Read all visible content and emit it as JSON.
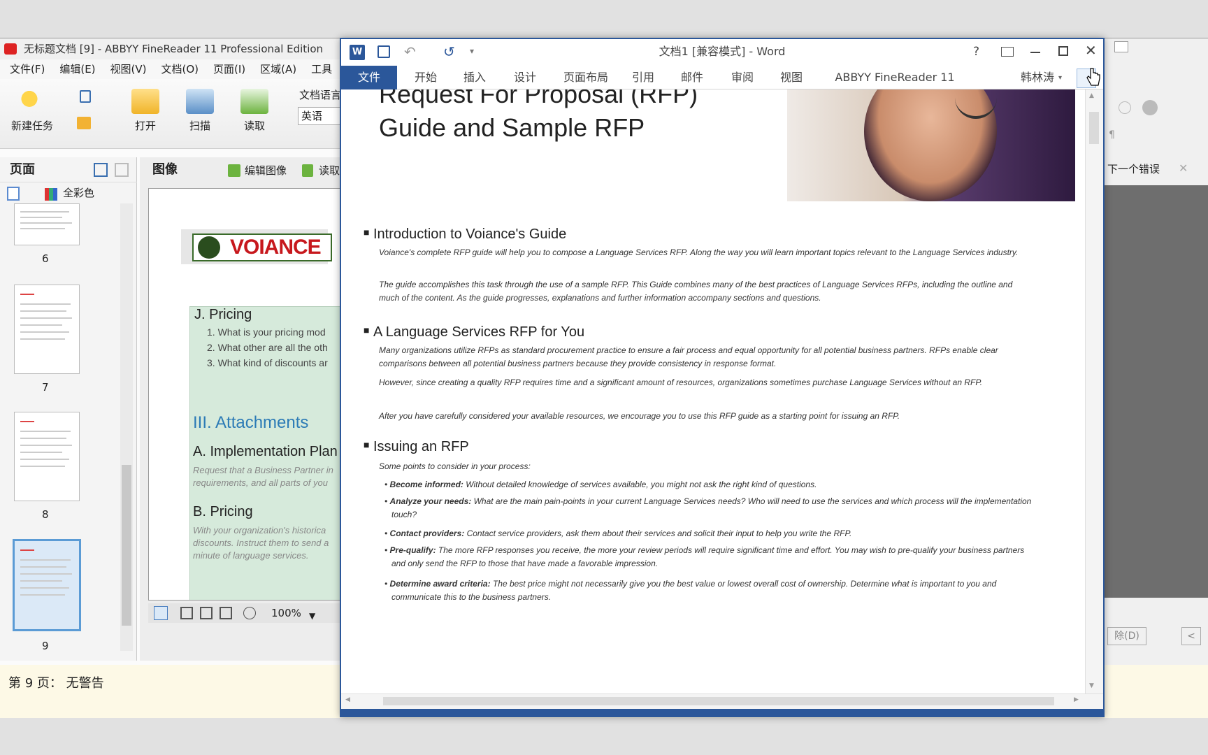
{
  "abbyy": {
    "title": "无标题文档 [9] - ABBYY FineReader 11 Professional Edition",
    "menu": [
      "文件(F)",
      "编辑(E)",
      "视图(V)",
      "文档(O)",
      "页面(I)",
      "区域(A)",
      "工具"
    ],
    "toolbar": {
      "new_task": "新建任务",
      "open": "打开",
      "scan": "扫描",
      "read": "读取",
      "doc_lang_label": "文档语言",
      "doc_lang_value": "英语"
    },
    "pages_panel": {
      "title": "页面",
      "color_mode": "全彩色",
      "page_numbers": [
        "6",
        "7",
        "8",
        "9"
      ]
    },
    "image_panel": {
      "title": "图像",
      "edit_image": "编辑图像",
      "read": "读取",
      "logo_text": "VOIANCE",
      "section_j": "J. Pricing",
      "j_items": [
        "1.  What is your pricing mod",
        "2.  What other are all the oth",
        "3.  What kind of discounts ar"
      ],
      "attachments": "III. Attachments",
      "impl_plan": "A. Implementation Plan",
      "impl_text": [
        "Request that a Business Partner in",
        "requirements, and all parts of you"
      ],
      "b_pricing": "B. Pricing",
      "b_text": [
        "With your organization's historica",
        "discounts. Instruct them to send a",
        "minute of language services."
      ],
      "zoom": "100%"
    },
    "right_panel": {
      "next_error": "下一个错误",
      "delete_btn": "除(D)"
    },
    "status": "第 9 页：  无警告"
  },
  "word": {
    "title": "文档1 [兼容模式] - Word",
    "help": "?",
    "user": "韩林涛",
    "tabs": [
      "文件",
      "开始",
      "插入",
      "设计",
      "页面布局",
      "引用",
      "邮件",
      "审阅",
      "视图",
      "ABBYY FineReader 11"
    ],
    "doc": {
      "title_line1": "Request For Proposal (RFP)",
      "title_line2": "Guide and Sample RFP",
      "sections": [
        {
          "heading": "Introduction to Voiance's Guide",
          "paras": [
            "Voiance's complete RFP guide will help you to compose a Language Services RFP. Along the way you will learn important topics relevant to the Language Services industry.",
            "The guide accomplishes this task through the use of a sample RFP. This Guide combines many of the best practices of Language Services RFPs, including the outline and much of the content. As the guide progresses, explanations and further information accompany sections and questions."
          ]
        },
        {
          "heading": "A Language Services RFP for You",
          "paras": [
            "Many organizations utilize RFPs as standard procurement practice to ensure a fair process and equal opportunity for all potential business partners. RFPs enable clear comparisons between all potential business partners because they provide consistency in response format.",
            "However, since creating a quality RFP requires time and a significant amount of resources, organizations sometimes purchase Language Services without an RFP.",
            "After you have carefully considered your available resources, we encourage you to use this RFP guide as a starting point for issuing an RFP."
          ]
        },
        {
          "heading": "Issuing an RFP",
          "intro": "Some points to consider in your process:",
          "bullets": [
            {
              "term": "Become informed:",
              "text": " Without detailed knowledge of services available, you might not ask the right kind of questions."
            },
            {
              "term": "Analyze your needs:",
              "text": " What are the main pain-points in your current Language Services needs? Who will need to use the services and which process will the implementation touch?"
            },
            {
              "term": "Contact providers:",
              "text": " Contact service providers, ask them about their services and solicit their input to help you write the RFP."
            },
            {
              "term": "Pre-qualify:",
              "text": " The more RFP responses you receive, the more your review periods will require significant time and effort. You may wish to pre-qualify your business partners and only send the RFP to those that have made a favorable impression."
            },
            {
              "term": "Determine award criteria:",
              "text": " The best price might not necessarily give you the best value or lowest overall cost of ownership. Determine what is important to you and communicate this to the business partners."
            }
          ]
        }
      ]
    }
  }
}
